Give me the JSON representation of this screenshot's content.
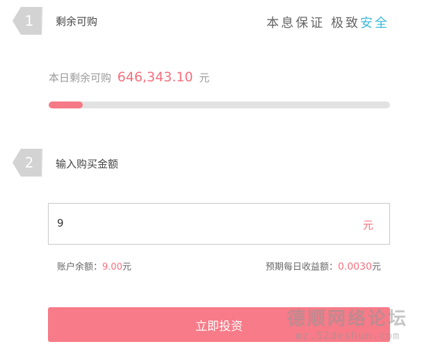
{
  "step1": {
    "number": "1",
    "title": "剩余可购"
  },
  "slogan": {
    "prefix": "本息保证  极致",
    "highlight": "安全"
  },
  "remaining": {
    "label": "本日剩余可购",
    "amount": "646,343.10",
    "unit": "元",
    "progress_fraction": 0.1
  },
  "step2": {
    "number": "2",
    "title": "输入购买金额"
  },
  "amount_input": {
    "value": "9",
    "unit": "元"
  },
  "account": {
    "balance_label": "账户余额：",
    "balance_value": "9.00",
    "balance_unit": "元",
    "expected_label": "预期每日收益额：",
    "expected_value": "0.0030",
    "expected_unit": "元"
  },
  "invest_button": "立即投资",
  "watermark": {
    "line1": "德顺网络论坛",
    "line2": "mz.52deshun.com"
  },
  "colors": {
    "accent": "#f77b88",
    "highlight": "#3cb9d8",
    "badge": "#d3d3d3"
  }
}
